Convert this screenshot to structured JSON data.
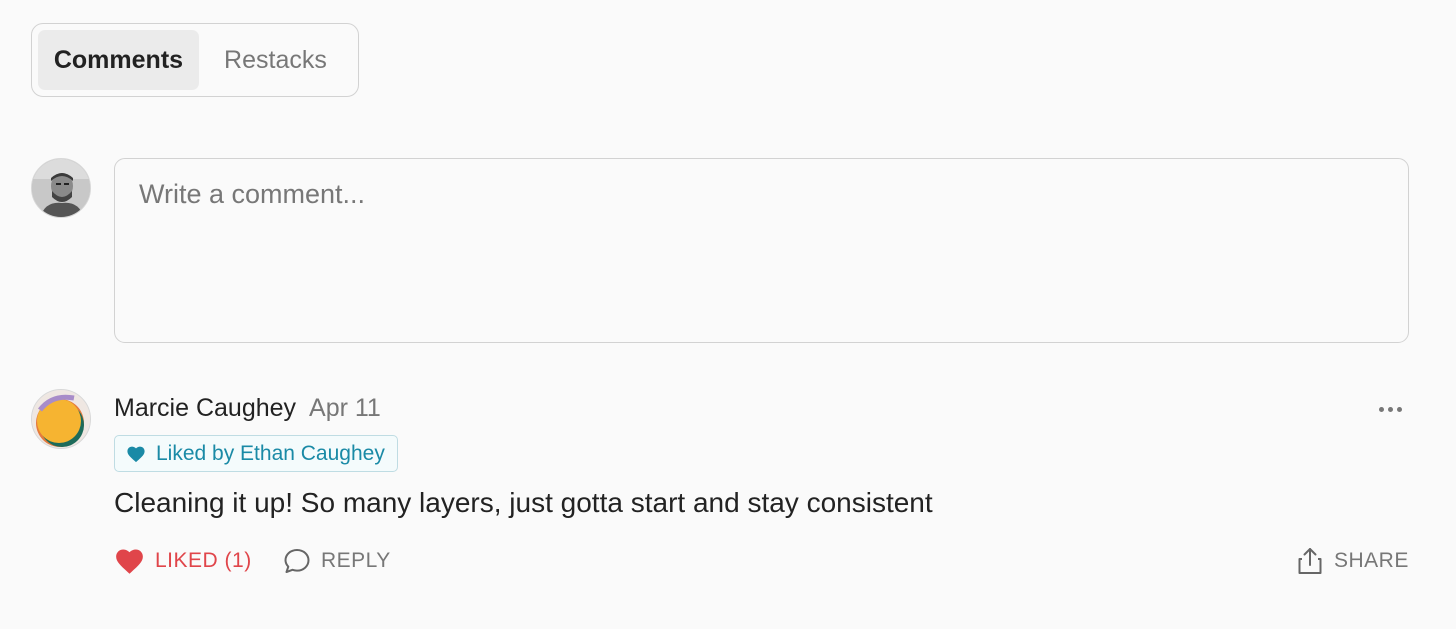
{
  "tabs": [
    {
      "label": "Comments",
      "active": true
    },
    {
      "label": "Restacks",
      "active": false
    }
  ],
  "composer": {
    "placeholder": "Write a comment..."
  },
  "comment": {
    "author": "Marcie Caughey",
    "date": "Apr 11",
    "liked_by": "Liked by Ethan Caughey",
    "text": "Cleaning it up! So many layers, just gotta start and stay consistent",
    "actions": {
      "like_label": "LIKED (1)",
      "reply_label": "REPLY",
      "share_label": "SHARE"
    }
  },
  "icons": {
    "like": "heart-icon",
    "reply": "speech-bubble-icon",
    "share": "share-icon",
    "more": "more-dots-icon",
    "liked_badge": "heart-icon"
  },
  "colors": {
    "liked": "#e0454a",
    "liked_by_badge": "#1a8aa6",
    "background": "#fafafa"
  }
}
